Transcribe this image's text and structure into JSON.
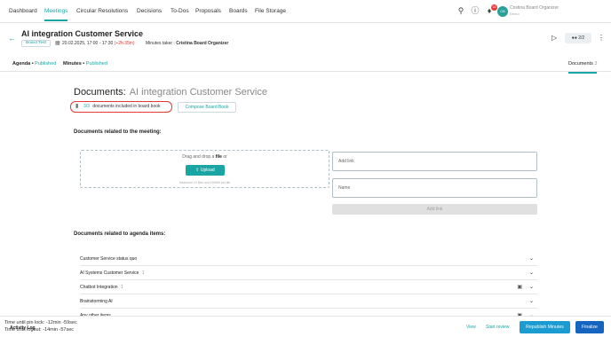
{
  "nav": {
    "items": [
      "Dashboard",
      "Meetings",
      "Circular Resolutions",
      "Decisions",
      "To-Dos",
      "Proposals",
      "Boards",
      "File Storage"
    ],
    "active": "Meetings",
    "notification_count": "18",
    "user": {
      "initials": "CB",
      "name": "Cristina Board Organizer",
      "role": "Demo"
    }
  },
  "meeting": {
    "title": "AI integration Customer Service",
    "board_tag": "Board Test",
    "datetime": "20.02.2025, 17:00 - 17:30",
    "relative": "(+2h 35m)",
    "minutes_taker_label": "Minutes taker :",
    "minutes_taker": "Cristina Board Organizer",
    "participants": "2/2"
  },
  "subtabs": {
    "agenda_label": "Agenda",
    "agenda_status": "Published",
    "minutes_label": "Minutes",
    "minutes_status": "Published",
    "documents_label": "Documents",
    "documents_count": "3"
  },
  "documents": {
    "heading": "Documents:",
    "heading_sub": "AI integration Customer Service",
    "board_book_count": "3/3",
    "board_book_text": "documents included in board book",
    "compose_label": "Compose Board Book",
    "meeting_section_title": "Documents related to the meeting:",
    "drop_text_pre": "Drag and drop a",
    "drop_text_bold": "file",
    "drop_text_post": "or",
    "upload_label": "Upload",
    "drop_hint": "Maximum 10 files and 150MB per file",
    "add_link_placeholder": "Add link",
    "name_placeholder": "Name",
    "add_link_button": "Add link",
    "agenda_section_title": "Documents related to agenda items:"
  },
  "agenda_items": [
    {
      "title": "Customer Service status quo",
      "count": "",
      "has_doc": false
    },
    {
      "title": "AI Systems Customer Service",
      "count": "1",
      "has_doc": false
    },
    {
      "title": "Chatbot Integration",
      "count": "1",
      "has_doc": true
    },
    {
      "title": "Brainstorming AI",
      "count": "",
      "has_doc": false
    },
    {
      "title": "Any other items",
      "count": "",
      "has_doc": true
    }
  ],
  "footer": {
    "pin_lock": "Time until pin lock: -12min -59sec",
    "logout": "Time until logout:   -14min -57sec",
    "activity_log": "Activity Log",
    "view": "View",
    "start_review": "Start review",
    "republish": "Republish Minutes",
    "finalize": "Finalize"
  },
  "colors": {
    "accent": "#1aa5a5",
    "primary": "#1565c0",
    "highlight_red": "#e53935"
  }
}
